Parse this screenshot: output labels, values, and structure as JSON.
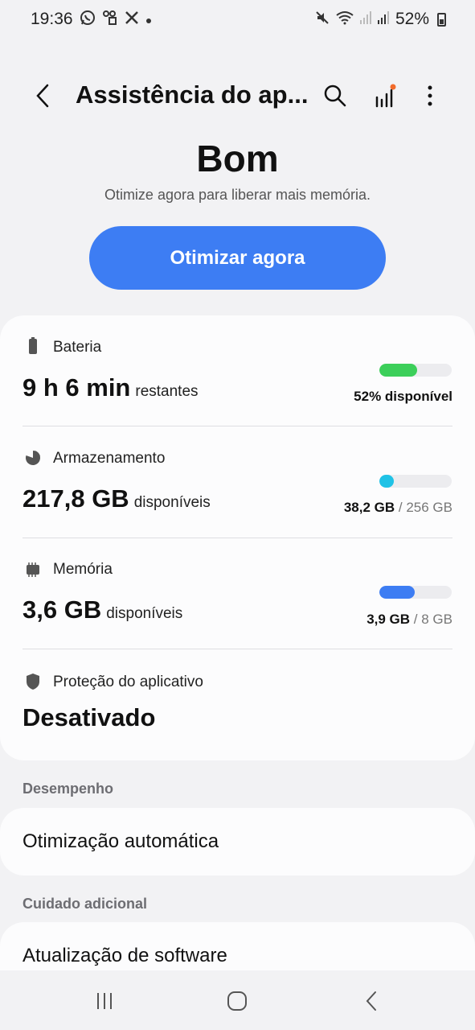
{
  "status_bar": {
    "time": "19:36",
    "battery_percent": "52%",
    "left_icons": [
      "whatsapp-icon",
      "app-notification-icon",
      "x-icon",
      "more-dot-icon"
    ],
    "right_icons": [
      "mute-icon",
      "wifi-icon",
      "signal-icon",
      "signal-icon",
      "battery-icon"
    ]
  },
  "header": {
    "title": "Assistência do ap...",
    "icons": [
      "back-icon",
      "search-icon",
      "stats-icon",
      "more-options-icon"
    ],
    "notification_dot_color": "#f26b2a"
  },
  "summary": {
    "status": "Bom",
    "subtitle": "Otimize agora para liberar mais memória.",
    "button_label": "Otimizar agora",
    "accent_color": "#3d7df3"
  },
  "battery": {
    "label": "Bateria",
    "value": "9 h 6 min",
    "suffix": "restantes",
    "meta": "52% disponível",
    "fill_fraction": 0.52,
    "color": "#3ccf5a"
  },
  "storage": {
    "label": "Armazenamento",
    "value": "217,8 GB",
    "suffix": "disponíveis",
    "used": "38,2 GB",
    "sep": "/",
    "total": "256 GB",
    "fill_fraction": 0.15,
    "color": "#1fc2e6"
  },
  "memory": {
    "label": "Memória",
    "value": "3,6 GB",
    "suffix": "disponíveis",
    "used": "3,9 GB",
    "sep": "/",
    "total": "8 GB",
    "fill_fraction": 0.49,
    "color": "#3d7df3"
  },
  "protection": {
    "label": "Proteção do aplicativo",
    "value": "Desativado"
  },
  "sections": {
    "performance": {
      "header": "Desempenho",
      "item": "Otimização automática"
    },
    "extra_care": {
      "header": "Cuidado adicional",
      "item": "Atualização de software"
    }
  },
  "nav": {
    "icons": [
      "recents-icon",
      "home-icon",
      "back-icon"
    ]
  }
}
